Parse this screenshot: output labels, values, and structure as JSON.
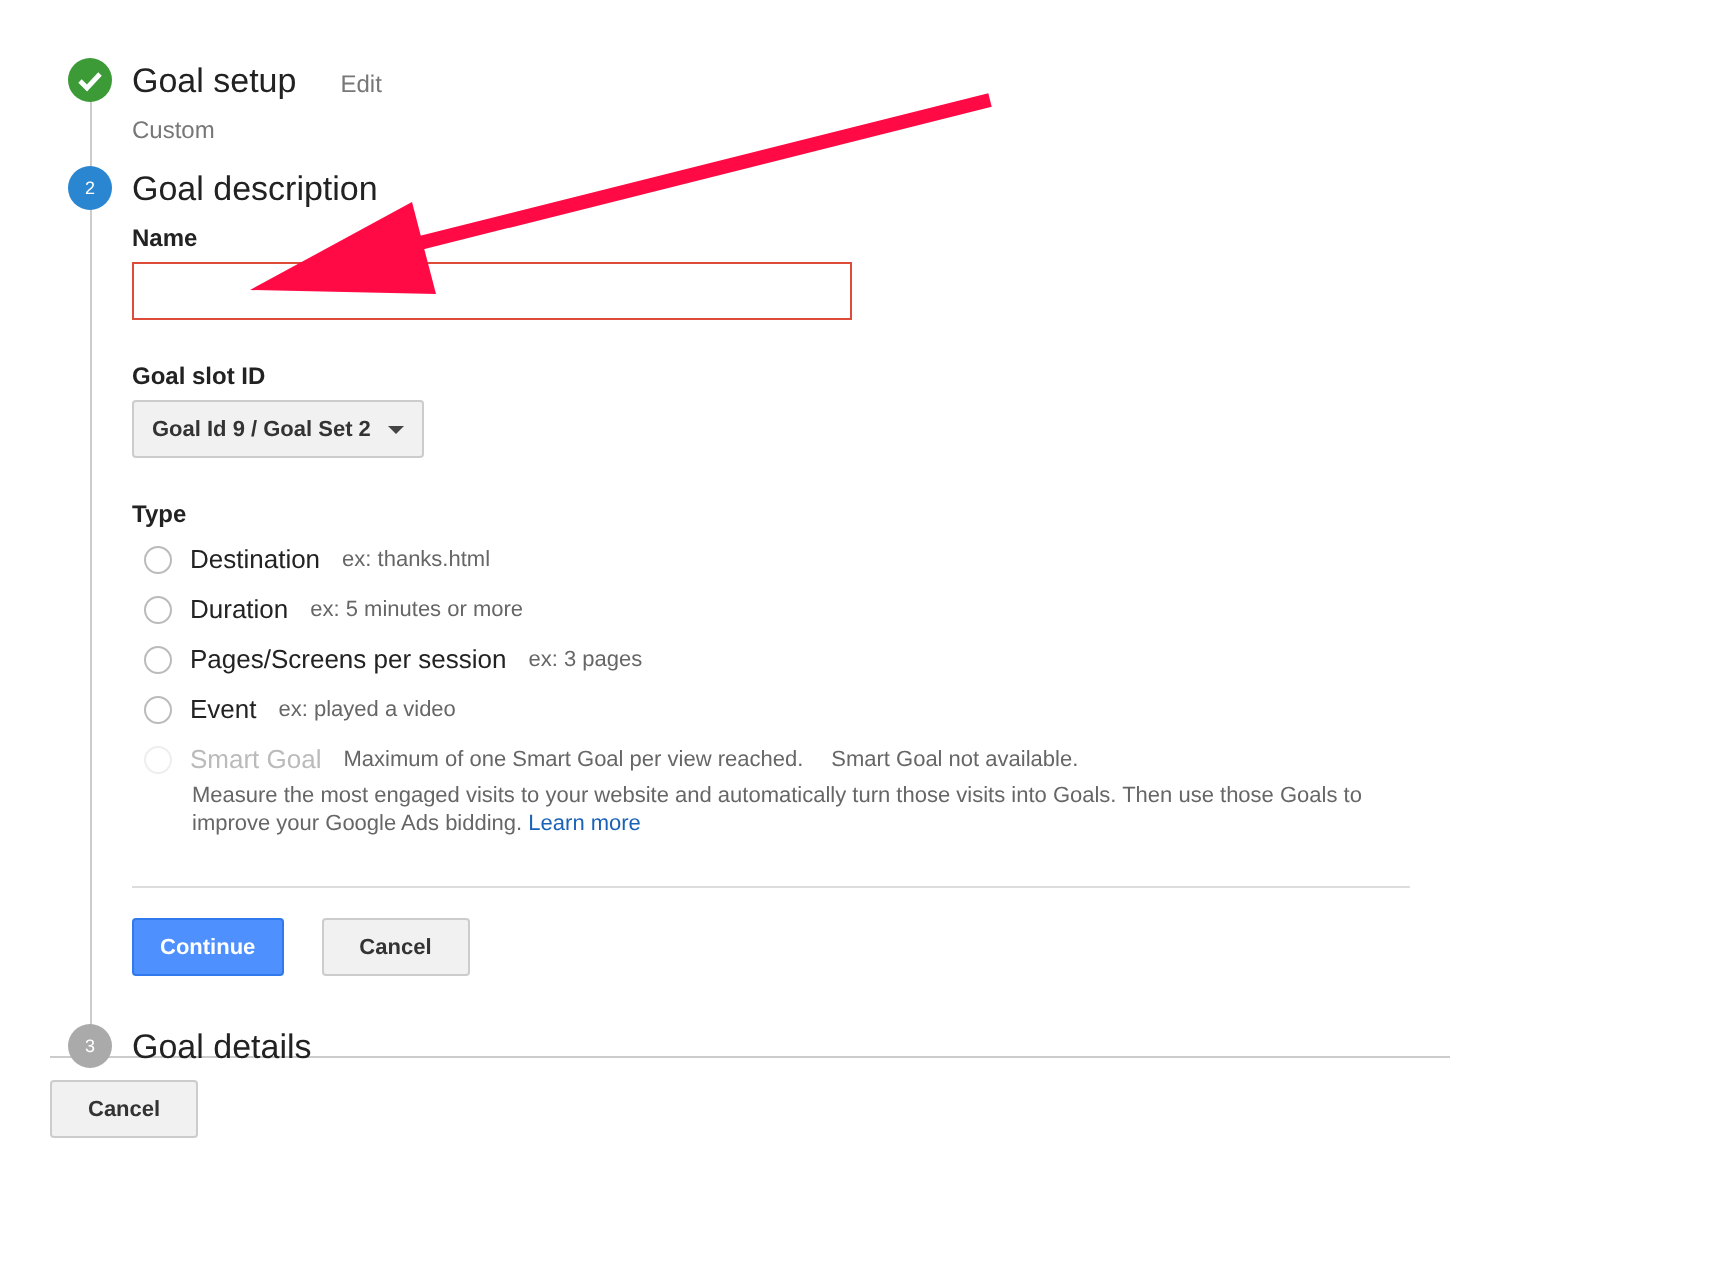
{
  "steps": [
    {
      "kind": "done",
      "title": "Goal setup",
      "edit": "Edit",
      "summary": "Custom"
    },
    {
      "kind": "active",
      "number": "2",
      "title": "Goal description"
    },
    {
      "kind": "pending",
      "number": "3",
      "title": "Goal details"
    }
  ],
  "name_field": {
    "label": "Name",
    "invalid": true
  },
  "goal_slot": {
    "label": "Goal slot ID",
    "value": "Goal Id 9 / Goal Set 2"
  },
  "type": {
    "label": "Type",
    "options": [
      {
        "label": "Destination",
        "hint": "ex: thanks.html",
        "selected": false,
        "disabled": false
      },
      {
        "label": "Duration",
        "hint": "ex: 5 minutes or more",
        "selected": false,
        "disabled": false
      },
      {
        "label": "Pages/Screens per session",
        "hint": "ex: 3 pages",
        "selected": false,
        "disabled": false
      },
      {
        "label": "Event",
        "hint": "ex: played a video",
        "selected": false,
        "disabled": false
      },
      {
        "label": "Smart Goal",
        "notes": [
          "Maximum of one Smart Goal per view reached.",
          "Smart Goal not available."
        ],
        "description": "Measure the most engaged visits to your website and automatically turn those visits into Goals. Then use those Goals to improve your Google Ads bidding.",
        "link": "Learn more",
        "selected": false,
        "disabled": true
      }
    ]
  },
  "buttons": [
    {
      "label": "Continue",
      "kind": "primary"
    },
    {
      "label": "Cancel",
      "kind": "secondary"
    }
  ],
  "footer_button": {
    "label": "Cancel"
  }
}
